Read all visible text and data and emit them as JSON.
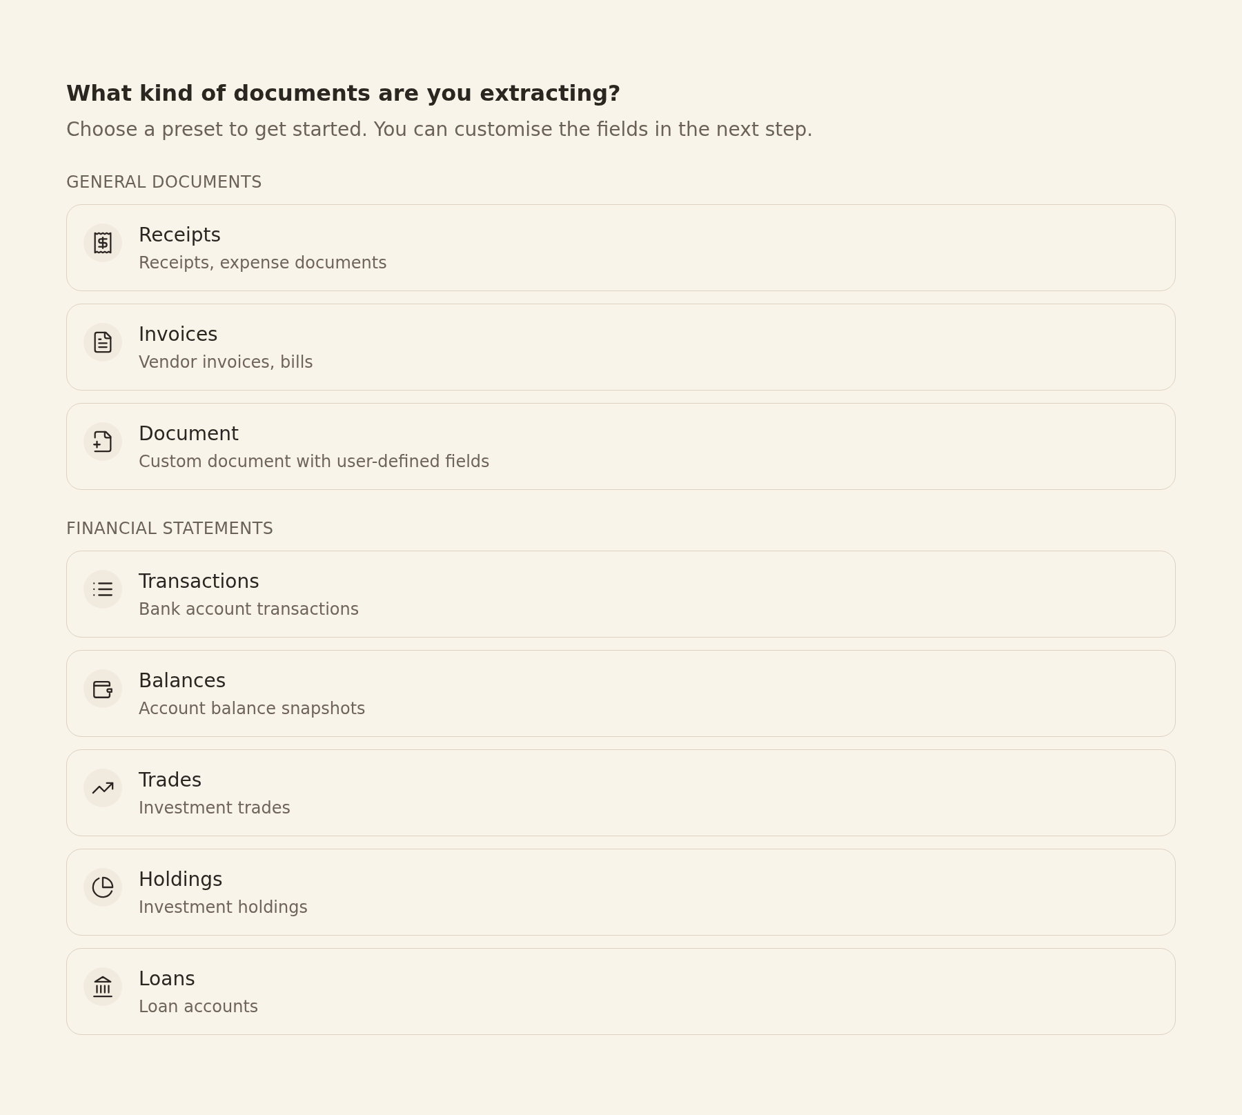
{
  "header": {
    "title": "What kind of documents are you extracting?",
    "subtitle": "Choose a preset to get started. You can customise the fields in the next step."
  },
  "sections": [
    {
      "heading": "GENERAL DOCUMENTS",
      "presets": [
        {
          "kind": "receipt",
          "title": "Receipts",
          "description": "Receipts, expense documents"
        },
        {
          "kind": "invoice",
          "title": "Invoices",
          "description": "Vendor invoices, bills"
        },
        {
          "kind": "document",
          "title": "Document",
          "description": "Custom document with user-defined fields"
        }
      ]
    },
    {
      "heading": "FINANCIAL STATEMENTS",
      "presets": [
        {
          "kind": "transactions",
          "title": "Transactions",
          "description": "Bank account transactions"
        },
        {
          "kind": "balances",
          "title": "Balances",
          "description": "Account balance snapshots"
        },
        {
          "kind": "trades",
          "title": "Trades",
          "description": "Investment trades"
        },
        {
          "kind": "holdings",
          "title": "Holdings",
          "description": "Investment holdings"
        },
        {
          "kind": "loans",
          "title": "Loans",
          "description": "Loan accounts"
        }
      ]
    }
  ]
}
